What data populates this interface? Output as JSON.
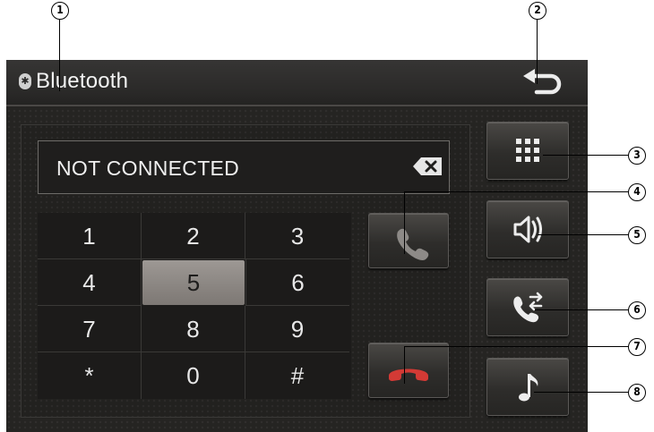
{
  "header": {
    "title": "Bluetooth",
    "bluetooth_icon": "bluetooth-icon",
    "back_icon": "back-arrow-icon"
  },
  "display": {
    "status_text": "NOT CONNECTED",
    "delete_icon": "backspace-icon"
  },
  "keypad": {
    "keys": [
      "1",
      "2",
      "3",
      "4",
      "5",
      "6",
      "7",
      "8",
      "9",
      "*",
      "0",
      "#"
    ],
    "highlighted_key": "5"
  },
  "call_buttons": [
    {
      "icon": "call-answer-icon"
    },
    {
      "icon": "call-end-icon"
    }
  ],
  "side_buttons": [
    {
      "icon": "keypad-grid-icon"
    },
    {
      "icon": "speaker-icon"
    },
    {
      "icon": "call-transfer-icon"
    },
    {
      "icon": "music-note-icon"
    }
  ],
  "callouts": [
    "1",
    "2",
    "3",
    "4",
    "5",
    "6",
    "7",
    "8"
  ],
  "colors": {
    "screen_bg": "#252422",
    "text": "#f0f0f0",
    "highlight_key": "#8e8985"
  }
}
